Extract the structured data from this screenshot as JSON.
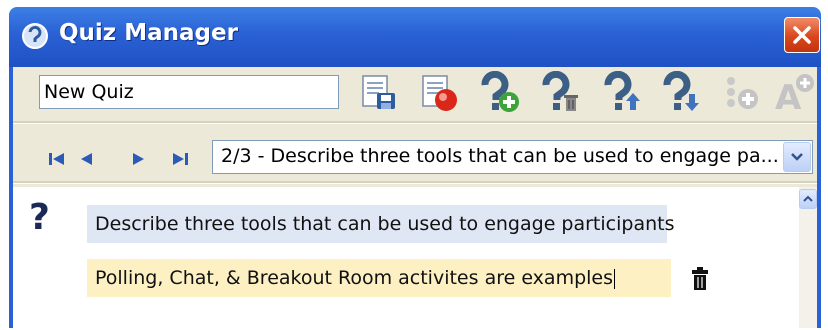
{
  "window": {
    "title": "Quiz Manager"
  },
  "toolbar": {
    "quiz_name_value": "New Quiz",
    "tools": [
      "save-quiz-icon",
      "record-quiz-icon",
      "add-question-icon",
      "delete-question-icon",
      "move-question-up-icon",
      "move-question-down-icon",
      "add-answer-icon",
      "text-settings-icon"
    ]
  },
  "navigation": {
    "buttons": [
      "first-icon",
      "previous-icon",
      "next-icon",
      "last-icon"
    ],
    "selected_question": "2/3 - Describe three tools that can be used to engage pa..."
  },
  "question": {
    "text": "Describe three tools that can be used to engage participants",
    "answer": "Polling, Chat, & Breakout Room activites are examples"
  },
  "colors": {
    "titlebar": "#2a61d4",
    "question_bg": "#dfe6f4",
    "answer_bg": "#fdf1c4",
    "close": "#d9471c"
  }
}
